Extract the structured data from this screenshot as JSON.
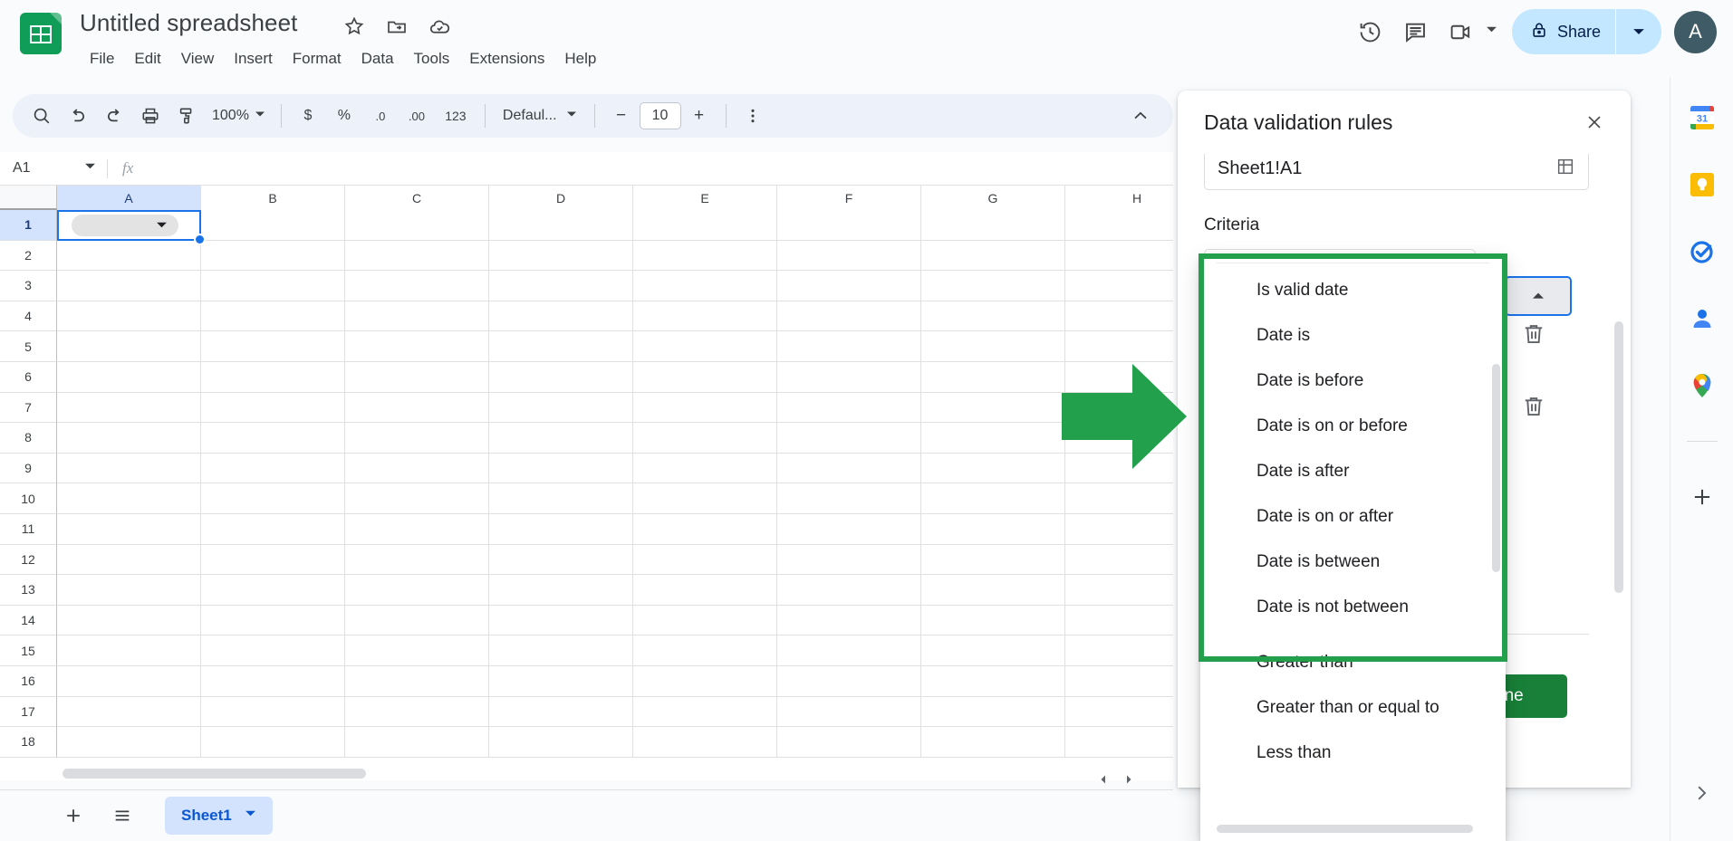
{
  "app": {
    "title": "Untitled spreadsheet",
    "logo_icon": "sheets-logo-icon"
  },
  "title_icons": [
    {
      "name": "star-icon",
      "label": "Star"
    },
    {
      "name": "move-to-folder-icon",
      "label": "Move"
    },
    {
      "name": "cloud-saved-icon",
      "label": "Saved to Drive"
    }
  ],
  "menubar": {
    "items": [
      "File",
      "Edit",
      "View",
      "Insert",
      "Format",
      "Data",
      "Tools",
      "Extensions",
      "Help"
    ]
  },
  "top_right": {
    "history_icon": "version-history-icon",
    "comment_icon": "comment-icon",
    "meet_icon": "meet-camera-icon",
    "meet_caret": "chevron-down-icon",
    "share_label": "Share",
    "share_lock_icon": "lock-icon",
    "share_caret_icon": "chevron-down-icon",
    "avatar_initial": "A"
  },
  "toolbar": {
    "search_icon": "search-icon",
    "undo_icon": "undo-icon",
    "redo_icon": "redo-icon",
    "print_icon": "print-icon",
    "paint_format_icon": "paint-format-icon",
    "zoom_value": "100%",
    "zoom_caret_icon": "chevron-down-icon",
    "currency_label": "$",
    "percent_label": "%",
    "decrease_decimal_label": ".0",
    "increase_decimal_label": ".00",
    "more_formats_label": "123",
    "font_label": "Defaul...",
    "font_caret_icon": "chevron-down-icon",
    "font_decrease_label": "−",
    "font_size_value": "10",
    "font_increase_label": "+",
    "more_icon": "more-vertical-icon",
    "collapse_icon": "chevron-up-icon"
  },
  "formula_bar": {
    "name_box_value": "A1",
    "name_box_caret_icon": "chevron-down-icon",
    "fx_label": "fx",
    "formula_value": ""
  },
  "grid": {
    "columns": [
      "A",
      "B",
      "C",
      "D",
      "E",
      "F",
      "G",
      "H"
    ],
    "rows": [
      "1",
      "2",
      "3",
      "4",
      "5",
      "6",
      "7",
      "8",
      "9",
      "10",
      "11",
      "12",
      "13",
      "14",
      "15",
      "16",
      "17",
      "18"
    ],
    "selected_cell": "A1",
    "selected_column": "A",
    "selected_row": "1",
    "cell_a1_chip_caret_icon": "chevron-down-icon"
  },
  "sheet_bar": {
    "add_sheet_icon": "plus-icon",
    "all_sheets_icon": "hamburger-list-icon",
    "tabs": [
      {
        "label": "Sheet1",
        "caret_icon": "chevron-down-icon",
        "active": true
      }
    ]
  },
  "data_validation_panel": {
    "title": "Data validation rules",
    "close_icon": "close-icon",
    "range_value": "Sheet1!A1",
    "range_picker_icon": "grid-select-icon",
    "criteria_label": "Criteria",
    "criteria_caret_icon": "chevron-up-icon",
    "delete_icons": [
      "trash-icon",
      "trash-icon"
    ],
    "done_label": "Done"
  },
  "criteria_dropdown": {
    "groups": [
      {
        "highlighted": true,
        "items": [
          "Is valid date",
          "Date is",
          "Date is before",
          "Date is on or before",
          "Date is after",
          "Date is on or after",
          "Date is between",
          "Date is not between"
        ]
      },
      {
        "highlighted": false,
        "items": [
          "Greater than",
          "Greater than or equal to",
          "Less than"
        ]
      }
    ]
  },
  "annotations": {
    "arrow_icon": "green-right-arrow-annotation",
    "highlight_box": "green-highlight-box-annotation",
    "accent_green": "#22a04b"
  },
  "side_rail": {
    "items": [
      {
        "name": "google-calendar-icon",
        "label": "Calendar"
      },
      {
        "name": "google-keep-icon",
        "label": "Keep"
      },
      {
        "name": "google-tasks-icon",
        "label": "Tasks"
      },
      {
        "name": "google-contacts-icon",
        "label": "Contacts"
      },
      {
        "name": "google-maps-icon",
        "label": "Maps"
      }
    ],
    "add_icon": "plus-icon",
    "expand_icon": "chevron-right-icon"
  },
  "colors": {
    "sheets_green": "#0f9d58",
    "accent_blue": "#1a73e8",
    "share_bg": "#c2e7ff",
    "toolbar_bg": "#edf2fa",
    "done_green": "#188038"
  }
}
